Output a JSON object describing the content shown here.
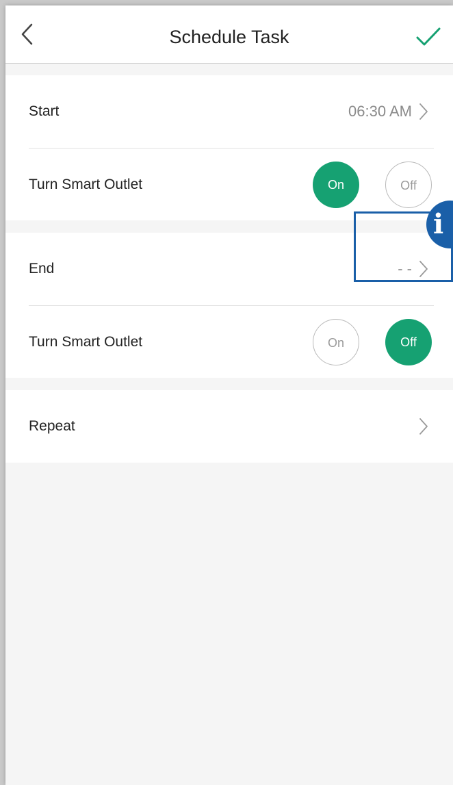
{
  "header": {
    "title": "Schedule Task",
    "back_icon": "chevron-left-icon",
    "confirm_icon": "checkmark-icon"
  },
  "start_group": {
    "start_label": "Start",
    "start_value": "06:30 AM",
    "action_label": "Turn Smart Outlet",
    "on_label": "On",
    "off_label": "Off",
    "selected": "On"
  },
  "end_group": {
    "end_label": "End",
    "end_value": "- -",
    "action_label": "Turn Smart Outlet",
    "on_label": "On",
    "off_label": "Off",
    "selected": "Off"
  },
  "repeat_group": {
    "repeat_label": "Repeat"
  },
  "annotation": {
    "badge_text": "i"
  },
  "colors": {
    "accent_green": "#16a172",
    "highlight_blue": "#1a5fa8",
    "background": "#f5f5f5"
  }
}
